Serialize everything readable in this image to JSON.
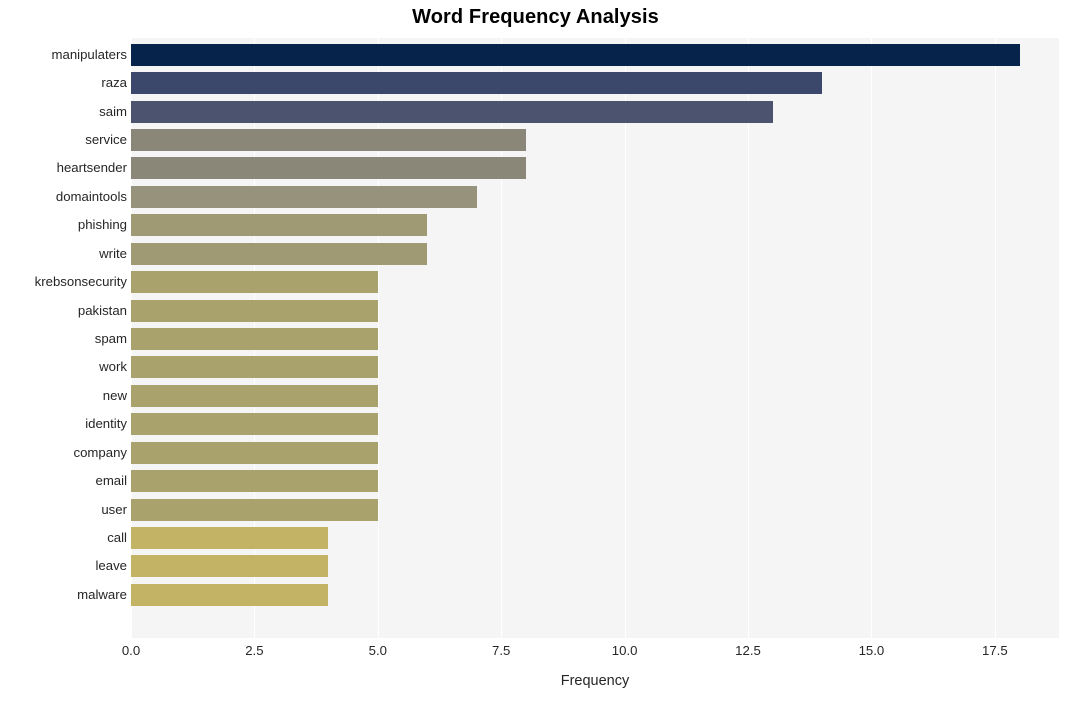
{
  "chart_data": {
    "type": "bar",
    "orientation": "horizontal",
    "title": "Word Frequency Analysis",
    "xlabel": "Frequency",
    "ylabel": "",
    "categories": [
      "manipulaters",
      "raza",
      "saim",
      "service",
      "heartsender",
      "domaintools",
      "phishing",
      "write",
      "krebsonsecurity",
      "pakistan",
      "spam",
      "work",
      "new",
      "identity",
      "company",
      "email",
      "user",
      "call",
      "leave",
      "malware"
    ],
    "values": [
      18,
      14,
      13,
      8,
      8,
      7,
      6,
      6,
      5,
      5,
      5,
      5,
      5,
      5,
      5,
      5,
      5,
      4,
      4,
      4
    ],
    "bar_colors": [
      "#06234b",
      "#3c486b",
      "#4b536e",
      "#8a8678",
      "#8a8678",
      "#96927c",
      "#a09a74",
      "#a09a74",
      "#aaa26d",
      "#aaa26d",
      "#aaa26d",
      "#aaa26d",
      "#aaa26d",
      "#aaa26d",
      "#aaa26d",
      "#aaa26d",
      "#aaa26d",
      "#c2b464",
      "#c2b464",
      "#c2b464"
    ],
    "xticks": [
      "0.0",
      "2.5",
      "5.0",
      "7.5",
      "10.0",
      "12.5",
      "15.0",
      "17.5"
    ],
    "xtick_values": [
      0,
      2.5,
      5,
      7.5,
      10,
      12.5,
      15,
      17.5
    ],
    "xlim": [
      0,
      18.8
    ],
    "grid": true,
    "grid_axis": "x",
    "legend": false,
    "plot_background": "#f5f5f5",
    "figure_background": "#ffffff",
    "gridline_color": "#ffffff",
    "text_color": "#262626",
    "title_color": "#000000"
  }
}
